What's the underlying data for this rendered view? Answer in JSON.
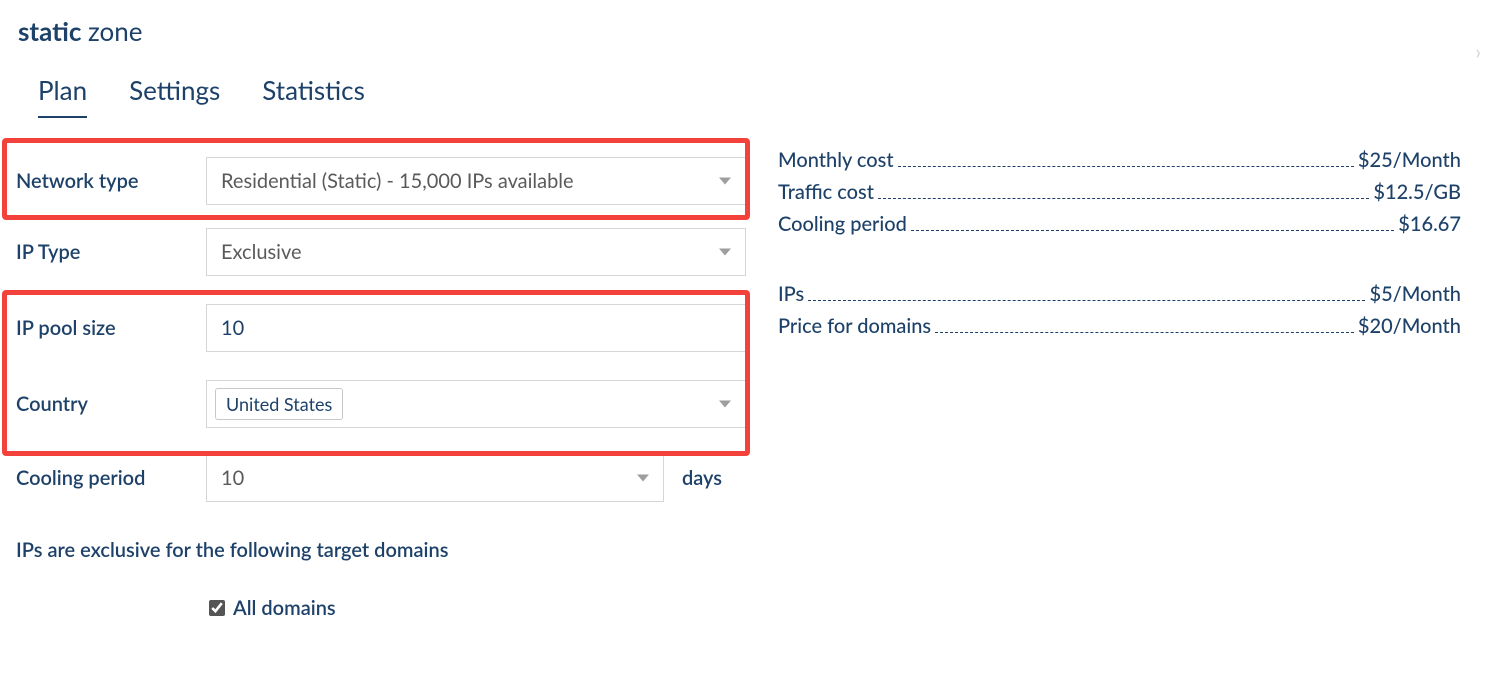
{
  "title": {
    "bold": "static",
    "rest": " zone"
  },
  "tabs": {
    "plan": "Plan",
    "settings": "Settings",
    "statistics": "Statistics"
  },
  "form": {
    "network_type": {
      "label": "Network type",
      "value": "Residential (Static) - 15,000 IPs available"
    },
    "ip_type": {
      "label": "IP Type",
      "value": "Exclusive"
    },
    "ip_pool_size": {
      "label": "IP pool size",
      "value": "10"
    },
    "country": {
      "label": "Country",
      "value": "United States"
    },
    "cooling_period": {
      "label": "Cooling period",
      "value": "10",
      "suffix": "days"
    },
    "domains_heading": "IPs are exclusive for the following target domains",
    "all_domains": "All domains"
  },
  "pricing": {
    "monthly_cost": {
      "label": "Monthly cost",
      "value": "$25/Month"
    },
    "traffic_cost": {
      "label": "Traffic cost",
      "value": "$12.5/GB"
    },
    "cooling_period": {
      "label": "Cooling period",
      "value": "$16.67"
    },
    "ips": {
      "label": "IPs",
      "value": "$5/Month"
    },
    "price_for_domains": {
      "label": "Price for domains",
      "value": "$20/Month"
    }
  }
}
